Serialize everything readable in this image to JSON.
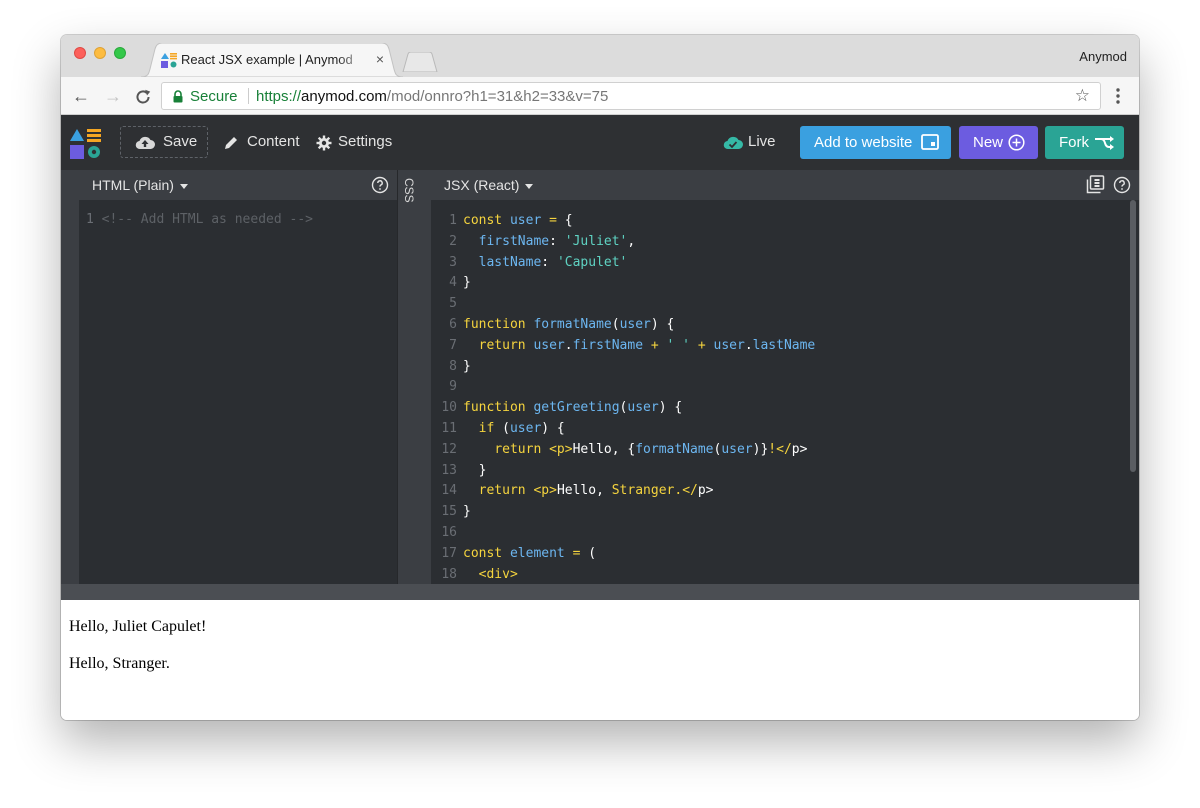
{
  "browser": {
    "tab_title": "React JSX example | Anymod",
    "profile": "Anymod",
    "secure_label": "Secure",
    "url_scheme": "https://",
    "url_host": "anymod.com",
    "url_path": "/mod/onnro?h1=31&h2=33&v=75"
  },
  "app_header": {
    "save": "Save",
    "content": "Content",
    "settings": "Settings",
    "live": "Live",
    "add_to_website": "Add to website",
    "new": "New",
    "fork": "Fork"
  },
  "html_pane": {
    "title": "HTML (Plain)",
    "line_number": "1",
    "code": "<!-- Add HTML as needed -->"
  },
  "css_strip": {
    "label": "CSS"
  },
  "jsx_pane": {
    "title": "JSX (React)",
    "lines": [
      {
        "n": "1",
        "tokens": [
          [
            "kw",
            "const "
          ],
          [
            "var",
            "user"
          ],
          [
            "kw",
            " = "
          ],
          [
            "punc",
            "{"
          ]
        ]
      },
      {
        "n": "2",
        "tokens": [
          [
            "punc",
            "  "
          ],
          [
            "var",
            "firstName"
          ],
          [
            "punc",
            ": "
          ],
          [
            "str",
            "'Juliet'"
          ],
          [
            "punc",
            ","
          ]
        ]
      },
      {
        "n": "3",
        "tokens": [
          [
            "punc",
            "  "
          ],
          [
            "var",
            "lastName"
          ],
          [
            "punc",
            ": "
          ],
          [
            "str",
            "'Capulet'"
          ]
        ]
      },
      {
        "n": "4",
        "tokens": [
          [
            "punc",
            "}"
          ]
        ]
      },
      {
        "n": "5",
        "tokens": []
      },
      {
        "n": "6",
        "tokens": [
          [
            "kw",
            "function "
          ],
          [
            "var",
            "formatName"
          ],
          [
            "punc",
            "("
          ],
          [
            "var",
            "user"
          ],
          [
            "punc",
            ") {"
          ]
        ]
      },
      {
        "n": "7",
        "tokens": [
          [
            "punc",
            "  "
          ],
          [
            "kw",
            "return "
          ],
          [
            "var",
            "user"
          ],
          [
            "punc",
            "."
          ],
          [
            "var",
            "firstName"
          ],
          [
            "kw",
            " + "
          ],
          [
            "str",
            "' '"
          ],
          [
            "kw",
            " + "
          ],
          [
            "var",
            "user"
          ],
          [
            "punc",
            "."
          ],
          [
            "var",
            "lastName"
          ]
        ]
      },
      {
        "n": "8",
        "tokens": [
          [
            "punc",
            "}"
          ]
        ]
      },
      {
        "n": "9",
        "tokens": []
      },
      {
        "n": "10",
        "tokens": [
          [
            "kw",
            "function "
          ],
          [
            "var",
            "getGreeting"
          ],
          [
            "punc",
            "("
          ],
          [
            "var",
            "user"
          ],
          [
            "punc",
            ") {"
          ]
        ]
      },
      {
        "n": "11",
        "tokens": [
          [
            "punc",
            "  "
          ],
          [
            "kw",
            "if "
          ],
          [
            "punc",
            "("
          ],
          [
            "var",
            "user"
          ],
          [
            "punc",
            ") {"
          ]
        ]
      },
      {
        "n": "12",
        "tokens": [
          [
            "punc",
            "    "
          ],
          [
            "kw",
            "return "
          ],
          [
            "tag",
            "<p>"
          ],
          [
            "punc",
            "Hello, {"
          ],
          [
            "var",
            "formatName"
          ],
          [
            "punc",
            "("
          ],
          [
            "var",
            "user"
          ],
          [
            "punc",
            ")}"
          ],
          [
            "jsxtext",
            "!"
          ],
          [
            "tag",
            "</"
          ],
          [
            "punc",
            "p>"
          ]
        ]
      },
      {
        "n": "13",
        "tokens": [
          [
            "punc",
            "  }"
          ]
        ]
      },
      {
        "n": "14",
        "tokens": [
          [
            "punc",
            "  "
          ],
          [
            "kw",
            "return "
          ],
          [
            "tag",
            "<p>"
          ],
          [
            "punc",
            "Hello, "
          ],
          [
            "jsxtext",
            "Stranger."
          ],
          [
            "tag",
            "</"
          ],
          [
            "punc",
            "p>"
          ]
        ]
      },
      {
        "n": "15",
        "tokens": [
          [
            "punc",
            "}"
          ]
        ]
      },
      {
        "n": "16",
        "tokens": []
      },
      {
        "n": "17",
        "tokens": [
          [
            "kw",
            "const "
          ],
          [
            "var",
            "element"
          ],
          [
            "kw",
            " = "
          ],
          [
            "punc",
            "("
          ]
        ]
      },
      {
        "n": "18",
        "tokens": [
          [
            "punc",
            "  "
          ],
          [
            "tag",
            "<div>"
          ]
        ]
      }
    ]
  },
  "preview": {
    "lines": [
      "Hello, Juliet Capulet!",
      "Hello, Stranger."
    ]
  },
  "colors": {
    "add_to_website": "#3aa0e0",
    "new": "#6c5ce0",
    "fork": "#2aa495",
    "live_cloud": "#35b9a6",
    "keyword": "#f5d43e",
    "variable": "#6cb6f0",
    "string": "#5fd3c3"
  }
}
